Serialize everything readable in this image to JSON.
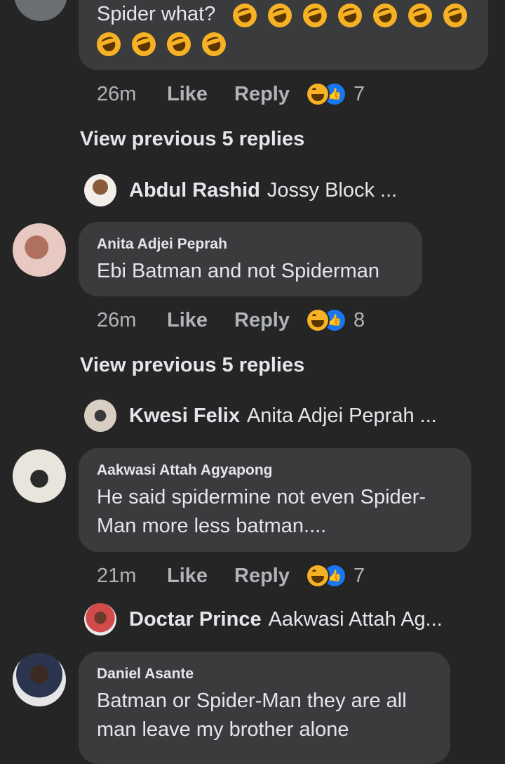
{
  "comment0": {
    "text": "Spider what?",
    "emoji_count": 11,
    "emoji_name": "rolling-on-floor-laughing",
    "time": "26m",
    "like": "Like",
    "reply": "Reply",
    "reaction_count": "7"
  },
  "view_prev_1": "View previous 5 replies",
  "reply_preview_1": {
    "name": "Abdul Rashid",
    "text": "Jossy Block ..."
  },
  "comment1": {
    "author": "Anita Adjei Peprah",
    "text": "Ebi Batman and not Spiderman",
    "time": "26m",
    "like": "Like",
    "reply": "Reply",
    "reaction_count": "8"
  },
  "view_prev_2": "View previous 5 replies",
  "reply_preview_2": {
    "name": "Kwesi Felix",
    "text": "Anita Adjei Peprah ..."
  },
  "comment2": {
    "author": "Aakwasi Attah Agyapong",
    "text_line1": "He said spidermine not even Spider-",
    "text_line2": "Man more less batman....",
    "time": "21m",
    "like": "Like",
    "reply": "Reply",
    "reaction_count": "7"
  },
  "reply_preview_3": {
    "name": "Doctar Prince",
    "text": "Aakwasi Attah Ag..."
  },
  "comment3": {
    "author": "Daniel Asante",
    "text_line1": "Batman or Spider-Man they are all",
    "text_line2": "man leave my brother alone"
  },
  "icons": {
    "reaction_laugh": "laugh-reaction-icon",
    "reaction_like": "like-reaction-icon"
  },
  "colors": {
    "background": "#252526",
    "bubble": "#3a3b3c",
    "like_blue": "#1877f2",
    "laugh_yellow": "#f7b125"
  }
}
